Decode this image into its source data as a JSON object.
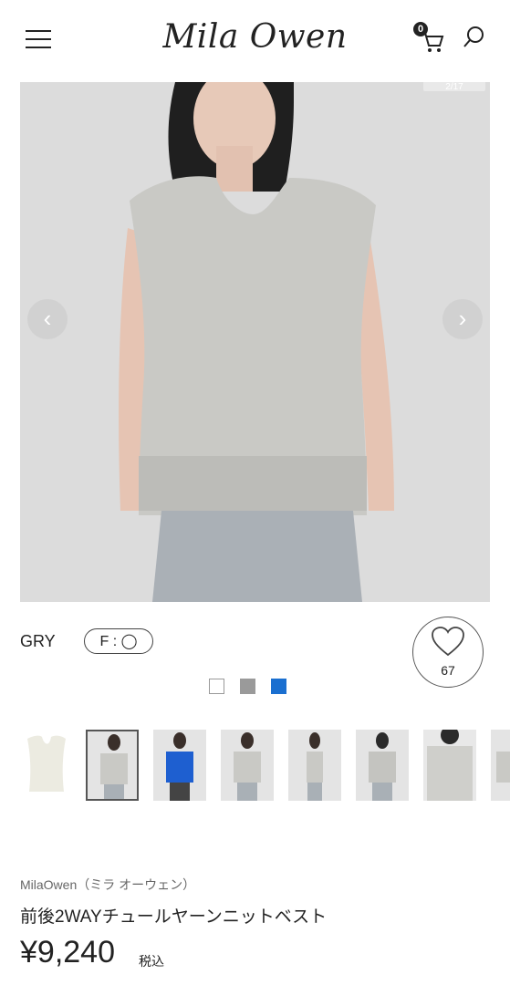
{
  "header": {
    "logo": "Mila Owen",
    "cart_count": "0",
    "icons": [
      "menu-icon",
      "cart-icon",
      "search-icon"
    ]
  },
  "gallery": {
    "counter": "2/17",
    "prev_icon": "‹",
    "next_icon": "›"
  },
  "selection": {
    "color_label": "GRY",
    "size_label": "F : ◯",
    "favorites_count": "67",
    "swatch_colors": [
      "#ffffff",
      "#9a9a9a",
      "#1a6fd0"
    ]
  },
  "product": {
    "brand": "MilaOwen（ミラ オーウェン）",
    "name": "前後2WAYチュールヤーンニットベスト",
    "price": "¥9,240",
    "tax_label": "税込"
  }
}
